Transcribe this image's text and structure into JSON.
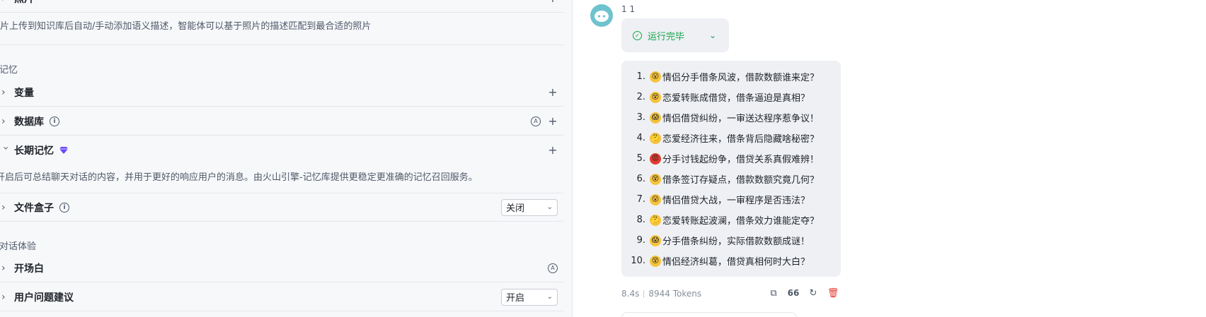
{
  "left": {
    "photo": {
      "title": "照片",
      "desc": "照片上传到知识库后自动/手动添加语义描述，智能体可以基于照片的描述匹配到最合适的照片"
    },
    "memory_section": "记忆",
    "variables": {
      "title": "变量"
    },
    "database": {
      "title": "数据库"
    },
    "long_memory": {
      "title": "长期记忆",
      "desc": "开启后可总结聊天对话的内容，并用于更好的响应用户的消息。由火山引擎-记忆库提供更稳定更准确的记忆召回服务。"
    },
    "file_box": {
      "title": "文件盒子",
      "value": "关闭"
    },
    "dialog_section": "对话体验",
    "opening": {
      "title": "开场白"
    },
    "suggestions": {
      "title": "用户问题建议",
      "value": "开启"
    }
  },
  "chat": {
    "bot_name": "1 1",
    "status": "运行完毕",
    "answers": [
      {
        "num": "1.",
        "emoji": "😮",
        "text": "情侣分手借条风波，借款数额谁来定？"
      },
      {
        "num": "2.",
        "emoji": "😵",
        "text": "恋爱转账成借贷，借条逼迫是真相？"
      },
      {
        "num": "3.",
        "emoji": "😱",
        "text": "情侣借贷纠纷，一审送达程序惹争议！"
      },
      {
        "num": "4.",
        "emoji": "🤔",
        "text": "恋爱经济往来，借条背后隐藏啥秘密？"
      },
      {
        "num": "5.",
        "emoji": "😡",
        "text": "分手讨钱起纷争，借贷关系真假难辨！"
      },
      {
        "num": "6.",
        "emoji": "😵",
        "text": "借条签订存疑点，借款数额究竟几何？"
      },
      {
        "num": "7.",
        "emoji": "😮",
        "text": "情侣借贷大战，一审程序是否违法？"
      },
      {
        "num": "8.",
        "emoji": "🤔",
        "text": "恋爱转账起波澜，借条效力谁能定夺？"
      },
      {
        "num": "9.",
        "emoji": "😱",
        "text": "分手借条纠纷，实际借款数额成谜！"
      },
      {
        "num": "10.",
        "emoji": "😵",
        "text": "情侣经济纠葛，借贷真相何时大白？"
      }
    ],
    "time": "8.4s",
    "tokens": "8944 Tokens",
    "actions": {
      "copy": "copy-icon",
      "quote": "66",
      "refresh": "refresh-icon",
      "delete": "trash-icon"
    }
  },
  "colors": {
    "success": "#16a34a",
    "danger": "#e23b2e",
    "avatar": "#6fc3cf"
  }
}
